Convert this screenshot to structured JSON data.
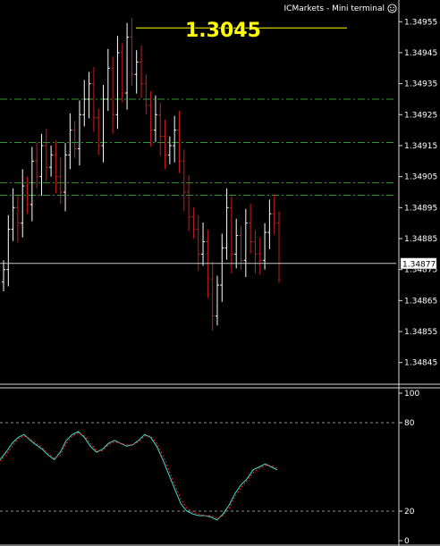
{
  "window": {
    "title": "ICMarkets - Mini terminal",
    "status_icon": "smiley-icon"
  },
  "overlay_price": "1.3045",
  "price_panel": {
    "current_price_label": "1.34877",
    "y_ticks": [
      "1.34955",
      "1.34945",
      "1.34935",
      "1.34925",
      "1.34915",
      "1.34905",
      "1.34895",
      "1.34885",
      "1.34875",
      "1.34865",
      "1.34855",
      "1.34845"
    ],
    "hidden_tick": "1.34875"
  },
  "oscillator_panel": {
    "y_ticks": [
      "100",
      "80",
      "20",
      "0"
    ]
  },
  "chart_data": [
    {
      "type": "line",
      "panel": "price",
      "description_of_series": "bar chart (OHLC ticks)",
      "ylim": [
        1.34838,
        1.34962
      ],
      "current_price": 1.34877,
      "reference_lines": [
        {
          "value": 1.34953,
          "style": "solid",
          "color": "#ffff00"
        },
        {
          "value": 1.3493,
          "style": "dash-dot",
          "color": "#2e9a2e"
        },
        {
          "value": 1.34916,
          "style": "dash-dot",
          "color": "#2e9a2e"
        },
        {
          "value": 1.34903,
          "style": "dash-dot",
          "color": "#2e9a2e"
        },
        {
          "value": 1.34899,
          "style": "dash-dot",
          "color": "#2e9a2e"
        }
      ],
      "closes": [
        1.34875,
        1.34888,
        1.34895,
        1.3489,
        1.34902,
        1.34896,
        1.3491,
        1.34905,
        1.34915,
        1.34908,
        1.34912,
        1.34905,
        1.349,
        1.34912,
        1.3492,
        1.34914,
        1.34925,
        1.3493,
        1.34935,
        1.34924,
        1.34915,
        1.3493,
        1.3494,
        1.34925,
        1.34945,
        1.34932,
        1.3495,
        1.34938,
        1.34942,
        1.34935,
        1.34928,
        1.3492,
        1.34925,
        1.34918,
        1.34912,
        1.34915,
        1.3492,
        1.3491,
        1.349,
        1.34892,
        1.34888,
        1.3488,
        1.34884,
        1.34872,
        1.3486,
        1.3487,
        1.34882,
        1.34895,
        1.3488,
        1.34886,
        1.34878,
        1.3489,
        1.34884,
        1.3488,
        1.34878,
        1.34887,
        1.34893,
        1.3489,
        1.34877
      ]
    },
    {
      "type": "line",
      "panel": "oscillator",
      "ylim": [
        0,
        100
      ],
      "reference_lines": [
        80,
        20
      ],
      "series": [
        {
          "color": "#40e0d0",
          "values": [
            55,
            60,
            66,
            70,
            72,
            68,
            65,
            62,
            58,
            55,
            60,
            68,
            72,
            74,
            70,
            64,
            60,
            62,
            66,
            68,
            66,
            64,
            65,
            68,
            72,
            70,
            64,
            55,
            45,
            35,
            25,
            20,
            18,
            17,
            17,
            16,
            14,
            18,
            24,
            32,
            38,
            42,
            48,
            50,
            52,
            50,
            48
          ]
        },
        {
          "color": "#ff2020",
          "values": [
            54,
            58,
            64,
            69,
            71,
            69,
            66,
            63,
            59,
            56,
            58,
            66,
            71,
            73,
            71,
            66,
            61,
            61,
            65,
            67,
            66,
            65,
            65,
            67,
            71,
            71,
            66,
            58,
            48,
            38,
            28,
            22,
            19,
            18,
            17,
            17,
            15,
            17,
            22,
            30,
            36,
            41,
            46,
            49,
            51,
            51,
            49
          ]
        }
      ]
    }
  ],
  "colors": {
    "background": "#000000",
    "bar_up": "#ffffff",
    "bar_down": "#c81e1e",
    "axis": "#d8d8d8",
    "grid_green": "#2e9a2e",
    "overlay_yellow": "#ffff00"
  }
}
